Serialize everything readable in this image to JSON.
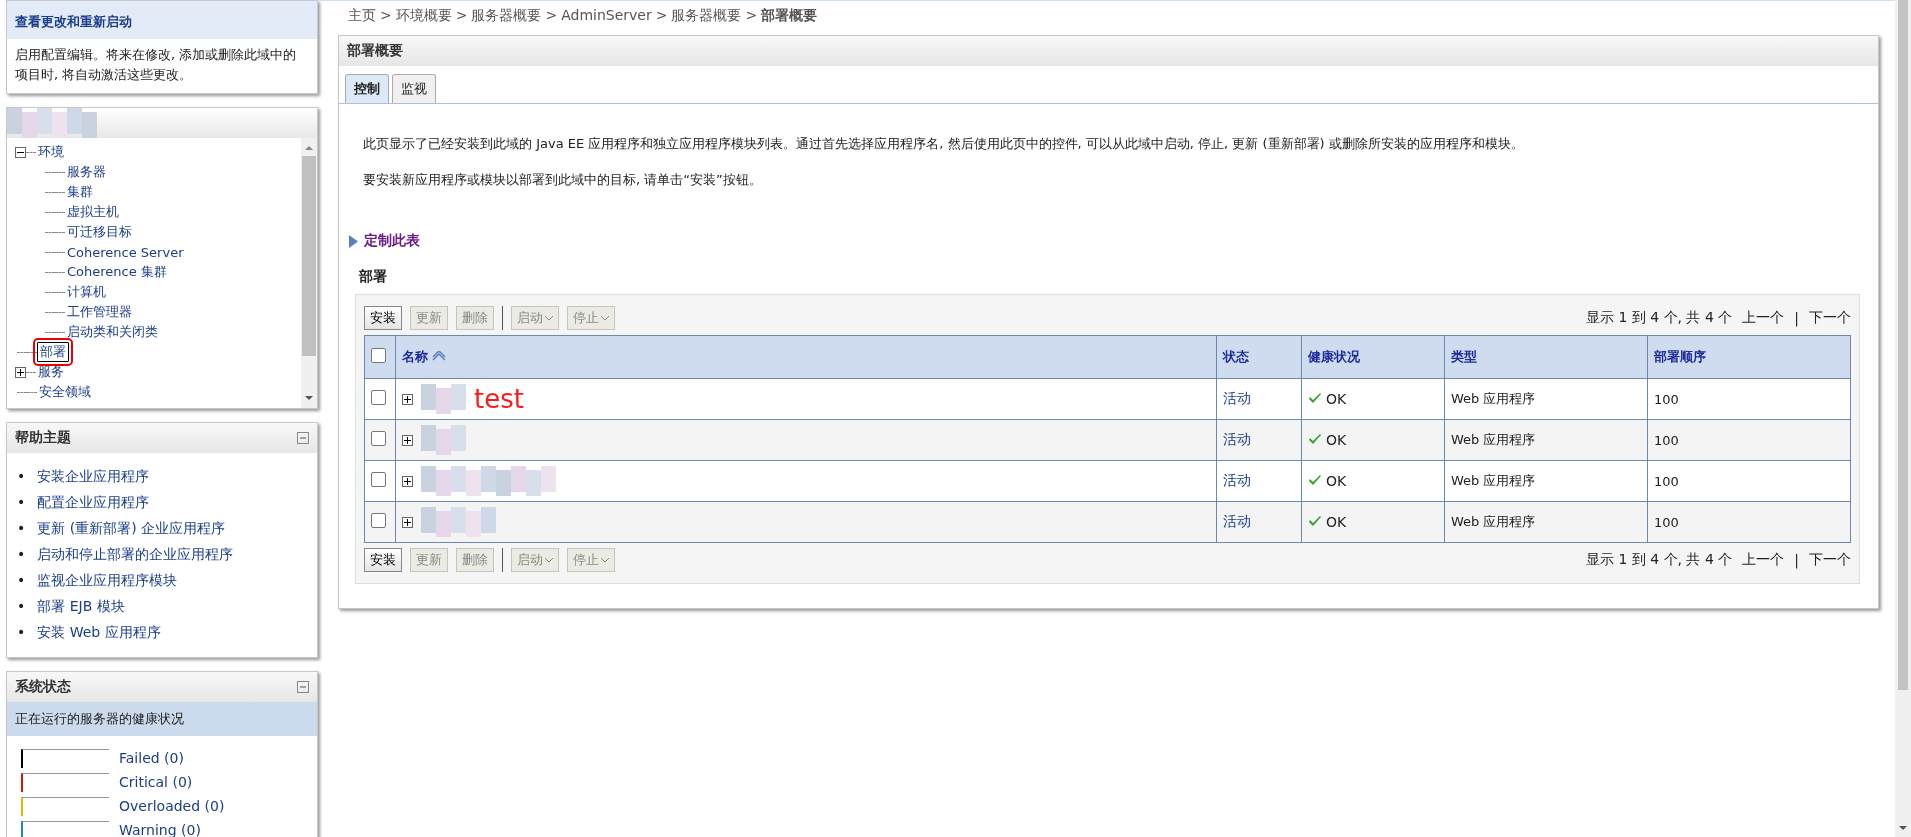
{
  "change_center": {
    "title": "查看更改和重新启动",
    "text": "启用配置编辑。将来在修改, 添加或删除此域中的项目时, 将自动激活这些更改。"
  },
  "domain_tree": {
    "items": [
      {
        "label": "环境",
        "expanded": true,
        "selected": false,
        "children": [
          {
            "label": "服务器",
            "selected": false
          },
          {
            "label": "集群",
            "selected": false
          },
          {
            "label": "虚拟主机",
            "selected": false
          },
          {
            "label": "可迁移目标",
            "selected": false
          },
          {
            "label": "Coherence Server",
            "selected": false
          },
          {
            "label": "Coherence 集群",
            "selected": false
          },
          {
            "label": "计算机",
            "selected": false
          },
          {
            "label": "工作管理器",
            "selected": false
          },
          {
            "label": "启动类和关闭类",
            "selected": false
          }
        ]
      },
      {
        "label": "部署",
        "selected": true
      },
      {
        "label": "服务",
        "expanded": false,
        "selected": false
      },
      {
        "label": "安全领域",
        "selected": false
      }
    ]
  },
  "help_topics": {
    "title": "帮助主题",
    "items": [
      {
        "bullet": "•",
        "label": "安装企业应用程序"
      },
      {
        "bullet": "•",
        "label": "配置企业应用程序"
      },
      {
        "bullet": "•",
        "label": "更新 (重新部署) 企业应用程序"
      },
      {
        "bullet": "•",
        "label": "启动和停止部署的企业应用程序"
      },
      {
        "bullet": "•",
        "label": "监视企业应用程序模块"
      },
      {
        "bullet": "•",
        "label": "部署 EJB 模块"
      },
      {
        "bullet": "•",
        "label": "安装 Web 应用程序"
      }
    ]
  },
  "system_status": {
    "title": "系统状态",
    "subtitle": "正在运行的服务器的健康状况",
    "items": [
      {
        "label": "Failed (0)",
        "color": "#000000"
      },
      {
        "label": "Critical (0)",
        "color": "#e01010"
      },
      {
        "label": "Overloaded (0)",
        "color": "#e8b800"
      },
      {
        "label": "Warning (0)",
        "color": "#208c9c"
      }
    ]
  },
  "breadcrumb": {
    "separator": ">",
    "items": [
      {
        "label": "主页",
        "current": false
      },
      {
        "label": "环境概要",
        "current": false
      },
      {
        "label": "服务器概要",
        "current": false
      },
      {
        "label": "AdminServer",
        "current": false
      },
      {
        "label": "服务器概要",
        "current": false
      },
      {
        "label": "部署概要",
        "current": true
      }
    ]
  },
  "panel": {
    "title": "部署概要",
    "tabs": [
      {
        "label": "控制",
        "selected": true
      },
      {
        "label": "监视",
        "selected": false
      }
    ],
    "description": [
      "此页显示了已经安装到此域的 Java EE 应用程序和独立应用程序模块列表。通过首先选择应用程序名, 然后使用此页中的控件, 可以从此域中启动, 停止, 更新 (重新部署) 或删除所安装的应用程序和模块。",
      "要安装新应用程序或模块以部署到此域中的目标, 请单击“安装”按钮。"
    ],
    "customize_link": "定制此表",
    "table_title": "部署",
    "toolbar_top": [
      {
        "label": "安装",
        "disabled": false,
        "kind": "button"
      },
      {
        "label": "更新",
        "disabled": true,
        "kind": "button"
      },
      {
        "label": "删除",
        "disabled": true,
        "kind": "button"
      },
      {
        "label": "启动",
        "disabled": true,
        "kind": "menu"
      },
      {
        "label": "停止",
        "disabled": true,
        "kind": "menu"
      }
    ],
    "pagination_top": {
      "summary": "显示 1 到 4 个, 共 4 个",
      "previous": "上一个",
      "separator": "|",
      "next": "下一个"
    },
    "select_all": {
      "checked": false
    },
    "columns": [
      {
        "label": "名称",
        "sorted": true
      },
      {
        "label": "状态",
        "sorted": false
      },
      {
        "label": "健康状况",
        "sorted": false
      },
      {
        "label": "类型",
        "sorted": false
      },
      {
        "label": "部署顺序",
        "sorted": false
      }
    ],
    "rows": [
      {
        "checked": false,
        "expanded": false,
        "annotation": "test",
        "state": "活动",
        "health": "OK",
        "type": "Web 应用程序",
        "order": "100"
      },
      {
        "checked": false,
        "expanded": false,
        "state": "活动",
        "health": "OK",
        "type": "Web 应用程序",
        "order": "100"
      },
      {
        "checked": false,
        "expanded": false,
        "state": "活动",
        "health": "OK",
        "type": "Web 应用程序",
        "order": "100"
      },
      {
        "checked": false,
        "expanded": false,
        "state": "活动",
        "health": "OK",
        "type": "Web 应用程序",
        "order": "100"
      }
    ],
    "toolbar_bottom": [
      {
        "label": "安装",
        "disabled": false,
        "kind": "button"
      },
      {
        "label": "更新",
        "disabled": true,
        "kind": "button"
      },
      {
        "label": "删除",
        "disabled": true,
        "kind": "button"
      },
      {
        "label": "启动",
        "disabled": true,
        "kind": "menu"
      },
      {
        "label": "停止",
        "disabled": true,
        "kind": "menu"
      }
    ],
    "pagination_bottom": {
      "summary": "显示 1 到 4 个, 共 4 个",
      "previous": "上一个",
      "separator": "|",
      "next": "下一个"
    }
  }
}
